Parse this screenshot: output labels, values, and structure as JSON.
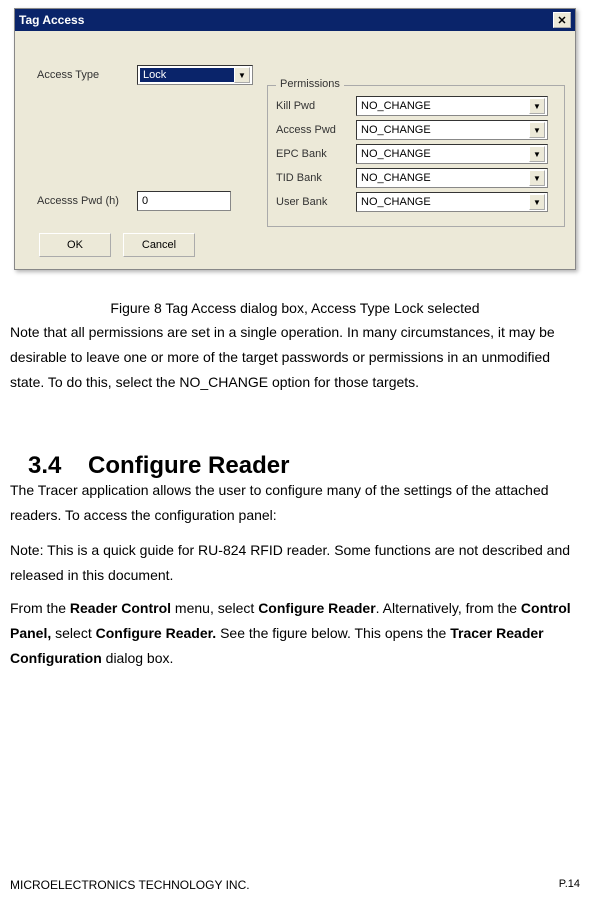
{
  "dialog": {
    "title": "Tag Access",
    "access_type_label": "Access Type",
    "access_type_value": "Lock",
    "access_pwd_label": "Accesss Pwd (h)",
    "access_pwd_value": "0",
    "permissions_legend": "Permissions",
    "perms": [
      {
        "label": "Kill Pwd",
        "value": "NO_CHANGE"
      },
      {
        "label": "Access Pwd",
        "value": "NO_CHANGE"
      },
      {
        "label": "EPC Bank",
        "value": "NO_CHANGE"
      },
      {
        "label": "TID Bank",
        "value": "NO_CHANGE"
      },
      {
        "label": "User Bank",
        "value": "NO_CHANGE"
      }
    ],
    "ok_label": "OK",
    "cancel_label": "Cancel"
  },
  "doc": {
    "caption": "Figure 8 Tag Access dialog box, Access Type Lock selected",
    "para1": "Note that all permissions are set in a single operation. In many circumstances, it may be desirable to leave one or more of the target passwords or permissions in an unmodified state. To do this, select the NO_CHANGE option for those targets.",
    "heading_num": "3.4",
    "heading_text": "Configure Reader",
    "para2": "The Tracer application allows the user to configure many of the settings of the attached readers.    To access the configuration panel:",
    "para3": "Note: This is a quick guide for RU-824 RFID reader. Some functions are not described and released in this document.",
    "para4_pre": "From the ",
    "para4_b1": "Reader Control",
    "para4_mid1": " menu, select ",
    "para4_b2": "Configure Reader",
    "para4_mid2": ". Alternatively, from the ",
    "para4_b3": "Control Panel,",
    "para4_mid3": " select ",
    "para4_b4": "Configure Reader.",
    "para4_mid4": " See the figure below. This opens the ",
    "para4_b5": "Tracer Reader Configuration",
    "para4_end": " dialog box.",
    "footer_left": "MICROELECTRONICS TECHNOLOGY INC.",
    "footer_right": "P.14"
  }
}
